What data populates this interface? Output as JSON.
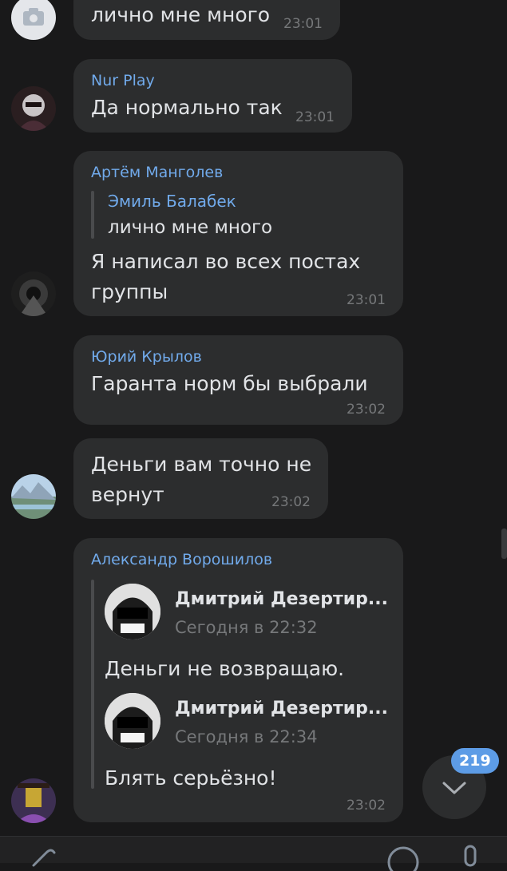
{
  "messages": [
    {
      "text": "лично мне много",
      "time": "23:01"
    },
    {
      "sender": "Nur Play",
      "text": "Да нормально так",
      "time": "23:01"
    },
    {
      "sender": "Артём Манголев",
      "reply_to": {
        "sender": "Эмиль Балабек",
        "text": "лично мне много"
      },
      "text_line1": "Я написал во всех постах",
      "text_line2": "группы",
      "time": "23:01"
    },
    {
      "sender": "Юрий Крылов",
      "text": "Гаранта норм бы выбрали",
      "time": "23:02"
    },
    {
      "text_line1": "Деньги вам точно не",
      "text_line2": "вернут",
      "time": "23:02"
    },
    {
      "sender": "Александр Ворошилов",
      "forwarded": [
        {
          "author": "Дмитрий Дезертир...",
          "date": "Сегодня в 22:32",
          "text": "Деньги не возвращаю."
        },
        {
          "author": "Дмитрий Дезертир...",
          "date": "Сегодня в 22:34",
          "text": "Блять серьёзно!"
        }
      ],
      "time": "23:02"
    }
  ],
  "unread_badge": "219",
  "icons": {
    "scroll_down": "chevron-down-icon",
    "camera": "camera-icon"
  },
  "colors": {
    "accent": "#71aaeb",
    "bubble": "#2c2d2e",
    "background": "#19191a",
    "badge": "#5d9ce6"
  }
}
